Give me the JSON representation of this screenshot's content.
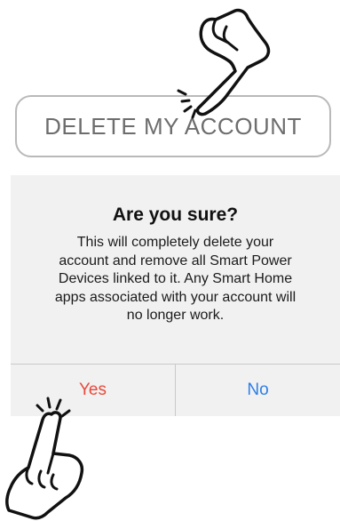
{
  "delete_button": {
    "label": "DELETE MY ACCOUNT"
  },
  "dialog": {
    "title": "Are you sure?",
    "message_lines": [
      "This will completely delete your",
      "account and remove all Smart Power",
      "Devices linked to it. Any Smart Home",
      "apps associated with your account will",
      "no longer work."
    ],
    "buttons": {
      "yes": {
        "label": "Yes",
        "color": "#e8493b"
      },
      "no": {
        "label": "No",
        "color": "#2d7fe6"
      }
    }
  },
  "icons": {
    "top_pointer": "pointing-hand-icon",
    "bottom_pointer": "pointing-hand-icon"
  }
}
